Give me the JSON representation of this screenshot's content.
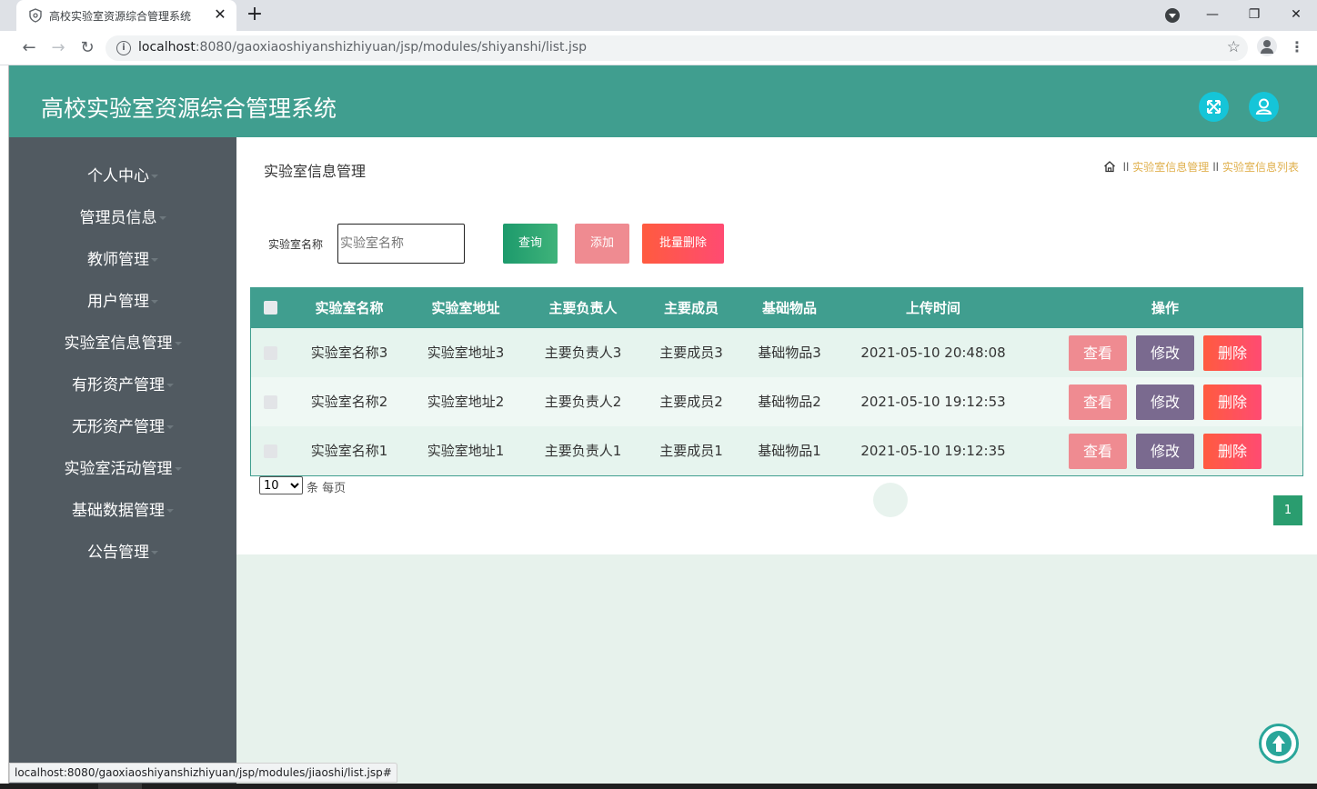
{
  "browser": {
    "tab_title": "高校实验室资源综合管理系统",
    "url_host": "localhost",
    "url_path": ":8080/gaoxiaoshiyanshizhiyuan/jsp/modules/shiyanshi/list.jsp",
    "status_url": "localhost:8080/gaoxiaoshiyanshizhiyuan/jsp/modules/jiaoshi/list.jsp#"
  },
  "header": {
    "title": "高校实验室资源综合管理系统",
    "fullscreen_icon": "expand-icon",
    "user_icon": "user-icon",
    "accent_color": "#409e8f",
    "icon_bg_color": "#15c5d8"
  },
  "sidebar": {
    "background": "#515a61",
    "items": [
      {
        "label": "个人中心"
      },
      {
        "label": "管理员信息"
      },
      {
        "label": "教师管理"
      },
      {
        "label": "用户管理"
      },
      {
        "label": "实验室信息管理"
      },
      {
        "label": "有形资产管理"
      },
      {
        "label": "无形资产管理"
      },
      {
        "label": "实验室活动管理"
      },
      {
        "label": "基础数据管理"
      },
      {
        "label": "公告管理"
      }
    ]
  },
  "main": {
    "page_title": "实验室信息管理",
    "breadcrumb": {
      "sep1": "ll",
      "item1": "实验室信息管理",
      "sep2": "ll",
      "item2": "实验室信息列表"
    },
    "search": {
      "label": "实验室名称",
      "placeholder": "实验室名称",
      "value": ""
    },
    "buttons": {
      "query": "查询",
      "add": "添加",
      "bulk_delete": "批量删除"
    },
    "table": {
      "columns": [
        "实验室名称",
        "实验室地址",
        "主要负责人",
        "主要成员",
        "基础物品",
        "上传时间",
        "操作"
      ],
      "rows": [
        {
          "name": "实验室名称3",
          "address": "实验室地址3",
          "leader": "主要负责人3",
          "members": "主要成员3",
          "items": "基础物品3",
          "time": "2021-05-10 20:48:08"
        },
        {
          "name": "实验室名称2",
          "address": "实验室地址2",
          "leader": "主要负责人2",
          "members": "主要成员2",
          "items": "基础物品2",
          "time": "2021-05-10 19:12:53"
        },
        {
          "name": "实验室名称1",
          "address": "实验室地址1",
          "leader": "主要负责人1",
          "members": "主要成员1",
          "items": "基础物品1",
          "time": "2021-05-10 19:12:35"
        }
      ],
      "actions": {
        "view": "查看",
        "edit": "修改",
        "delete": "删除"
      }
    },
    "pagination": {
      "page_size": "10",
      "page_size_options": [
        "10"
      ],
      "page_size_label": "条 每页",
      "current_page": "1"
    }
  }
}
